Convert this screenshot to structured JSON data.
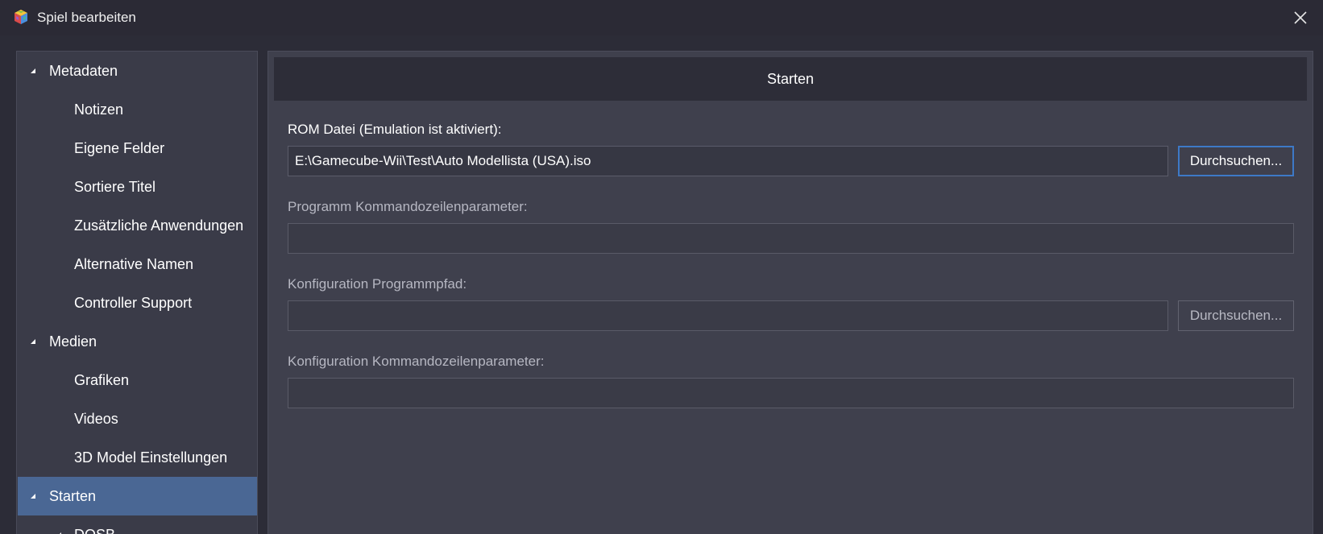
{
  "window": {
    "title": "Spiel bearbeiten"
  },
  "sidebar": {
    "items": [
      {
        "label": "Metadaten",
        "level": 0,
        "expanded": true,
        "selected": false
      },
      {
        "label": "Notizen",
        "level": 1,
        "selected": false
      },
      {
        "label": "Eigene Felder",
        "level": 1,
        "selected": false
      },
      {
        "label": "Sortiere Titel",
        "level": 1,
        "selected": false
      },
      {
        "label": "Zusätzliche Anwendungen",
        "level": 1,
        "selected": false
      },
      {
        "label": "Alternative Namen",
        "level": 1,
        "selected": false
      },
      {
        "label": "Controller Support",
        "level": 1,
        "selected": false
      },
      {
        "label": "Medien",
        "level": 0,
        "expanded": true,
        "selected": false
      },
      {
        "label": "Grafiken",
        "level": 1,
        "selected": false
      },
      {
        "label": "Videos",
        "level": 1,
        "selected": false
      },
      {
        "label": "3D Model Einstellungen",
        "level": 1,
        "selected": false
      },
      {
        "label": "Starten",
        "level": 0,
        "expanded": true,
        "selected": true
      },
      {
        "label": "DOSB",
        "level": 1,
        "selected": false
      }
    ]
  },
  "main": {
    "header": "Starten",
    "rom_label": "ROM Datei (Emulation ist aktiviert):",
    "rom_value": "E:\\Gamecube-Wii\\Test\\Auto Modellista (USA).iso",
    "rom_browse": "Durchsuchen...",
    "cmd_label": "Programm Kommandozeilenparameter:",
    "cmd_value": "",
    "config_path_label": "Konfiguration Programmpfad:",
    "config_path_value": "",
    "config_browse": "Durchsuchen...",
    "config_cmd_label": "Konfiguration Kommandozeilenparameter:",
    "config_cmd_value": ""
  },
  "colors": {
    "selected": "#4a6794",
    "accent_border": "#3d79c7"
  }
}
